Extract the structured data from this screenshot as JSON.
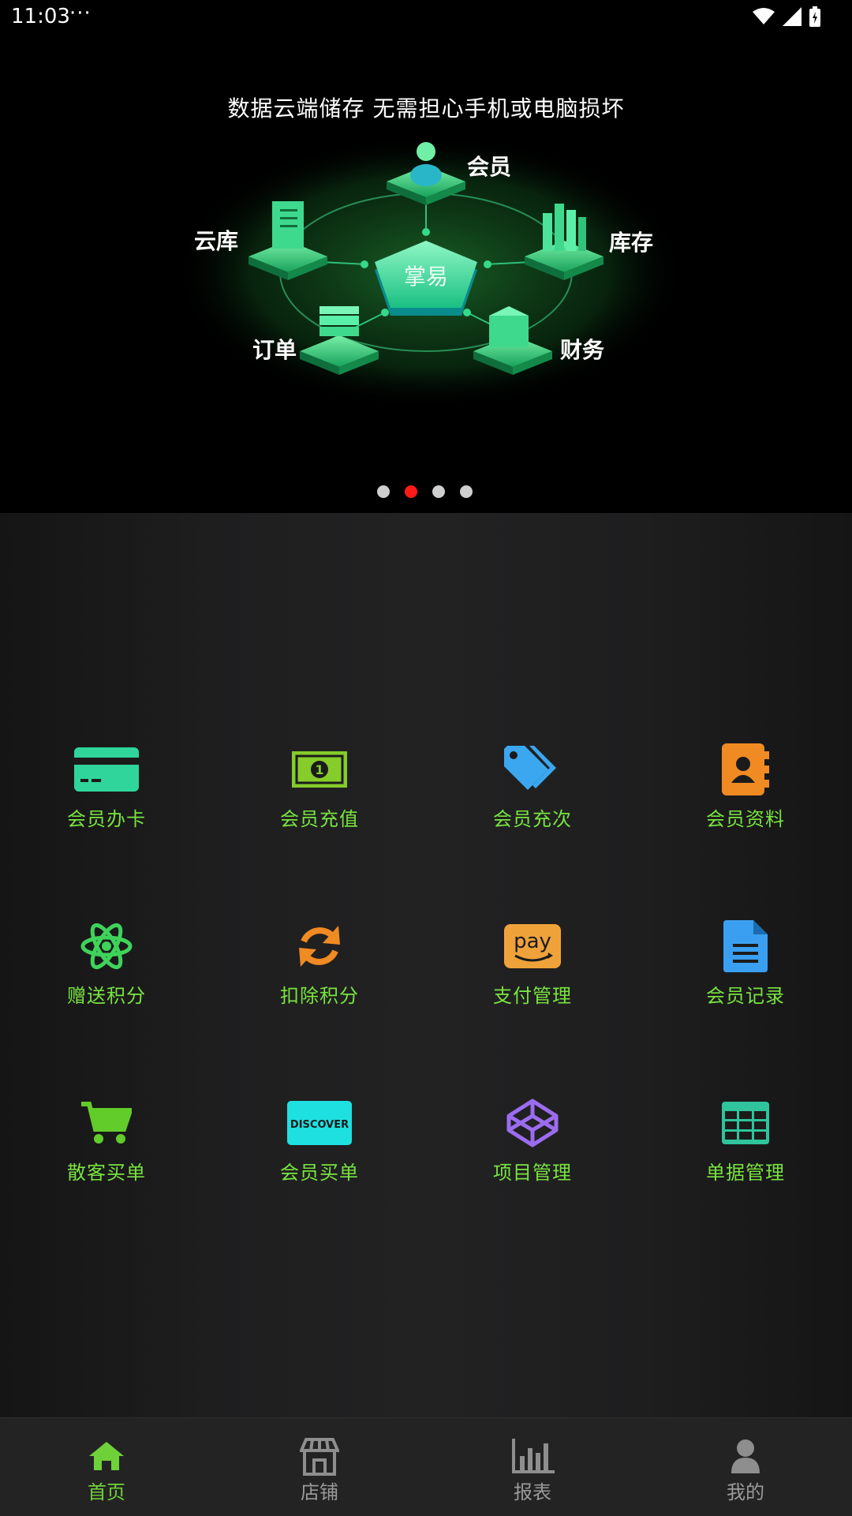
{
  "status_bar": {
    "time": "11:03",
    "more": "···"
  },
  "banner": {
    "caption": "数据云端储存 无需担心手机或电脑损坏",
    "center_label": "掌易",
    "nodes": {
      "member": "会员",
      "stock": "库存",
      "finance": "财务",
      "order": "订单",
      "cloud": "云库"
    },
    "pages": 4,
    "active_page": 2
  },
  "grid": [
    {
      "label": "会员办卡",
      "icon": "credit-card-icon",
      "color": "#2fd59b"
    },
    {
      "label": "会员充值",
      "icon": "money-bill-icon",
      "color": "#86cc2a"
    },
    {
      "label": "会员充次",
      "icon": "tags-icon",
      "color": "#3aa7f0"
    },
    {
      "label": "会员资料",
      "icon": "address-book-icon",
      "color": "#f08a22"
    },
    {
      "label": "赠送积分",
      "icon": "atom-icon",
      "color": "#3ed35a"
    },
    {
      "label": "扣除积分",
      "icon": "sync-icon",
      "color": "#f08a22"
    },
    {
      "label": "支付管理",
      "icon": "amazon-pay-icon",
      "color": "#f0a23a"
    },
    {
      "label": "会员记录",
      "icon": "file-text-icon",
      "color": "#3a9ff0"
    },
    {
      "label": "散客买单",
      "icon": "cart-icon",
      "color": "#62cc2a"
    },
    {
      "label": "会员买单",
      "icon": "discover-card-icon",
      "color": "#1ee0e0"
    },
    {
      "label": "项目管理",
      "icon": "codepen-icon",
      "color": "#9b6cf0"
    },
    {
      "label": "单据管理",
      "icon": "table-icon",
      "color": "#2fc49b"
    }
  ],
  "bottom_nav": [
    {
      "label": "首页",
      "icon": "home-icon",
      "active": true
    },
    {
      "label": "店铺",
      "icon": "store-icon",
      "active": false
    },
    {
      "label": "报表",
      "icon": "chart-bar-icon",
      "active": false
    },
    {
      "label": "我的",
      "icon": "user-icon",
      "active": false
    }
  ],
  "colors": {
    "accent": "#6fd13a",
    "label": "#79e43f",
    "pager_active": "#ff1a1a"
  }
}
